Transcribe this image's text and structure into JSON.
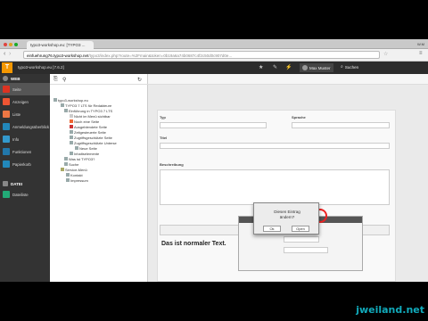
{
  "browser": {
    "tab_title": "typo3-workshop.eu: [TYPO3 ...",
    "url_host": "einfuehrung76.typo3-workshop.net",
    "url_path": "/typo3/index.php?route=%2Fmain&token=0b19a6a74b0687c4f2c50d0c907d0e...",
    "window_label": "W.M"
  },
  "topbar": {
    "site_label": "typo3-workshop.eu [7.6.2]",
    "user_name": "Max Muster",
    "search_label": "Suchen"
  },
  "sidebar": {
    "groups": [
      {
        "label": "WEB",
        "items": [
          "Seite",
          "Anzeigen",
          "Liste",
          "Anmeldungsüberblick",
          "Info",
          "Funktionen",
          "Papierkorb"
        ]
      },
      {
        "label": "DATEI",
        "items": [
          "Dateiliste"
        ]
      }
    ]
  },
  "tree": {
    "nodes": [
      "typo3-workshop.eu",
      "TYPO3 7 LTS für Redakteure",
      "Einführung in TYPO3 7 LTS",
      "Nicht im Menü sichtbar",
      "Noch eine Seite",
      "Ausgeblendete Seite",
      "Zeitgesteuerte Seite",
      "Zugriffsgeschützte Seite",
      "Zugriffsgeschützte Unterse",
      "Neue Seite",
      "Inhaltselemente",
      "Was ist TYPO3?",
      "Suche",
      "Service-Menü",
      "Kontakt",
      "Impressum"
    ]
  },
  "content": {
    "left_labels": [
      "Typ",
      "Titel",
      "Beschreibung"
    ],
    "right_label": "Sprache",
    "bottom_heading": "Das ist normaler Text."
  },
  "dialog": {
    "message_line1": "Diesen Eintrag",
    "message_line2": "ändern?",
    "ok": "Ok",
    "cancel": "Open"
  },
  "watermark": "jweiland.net"
}
